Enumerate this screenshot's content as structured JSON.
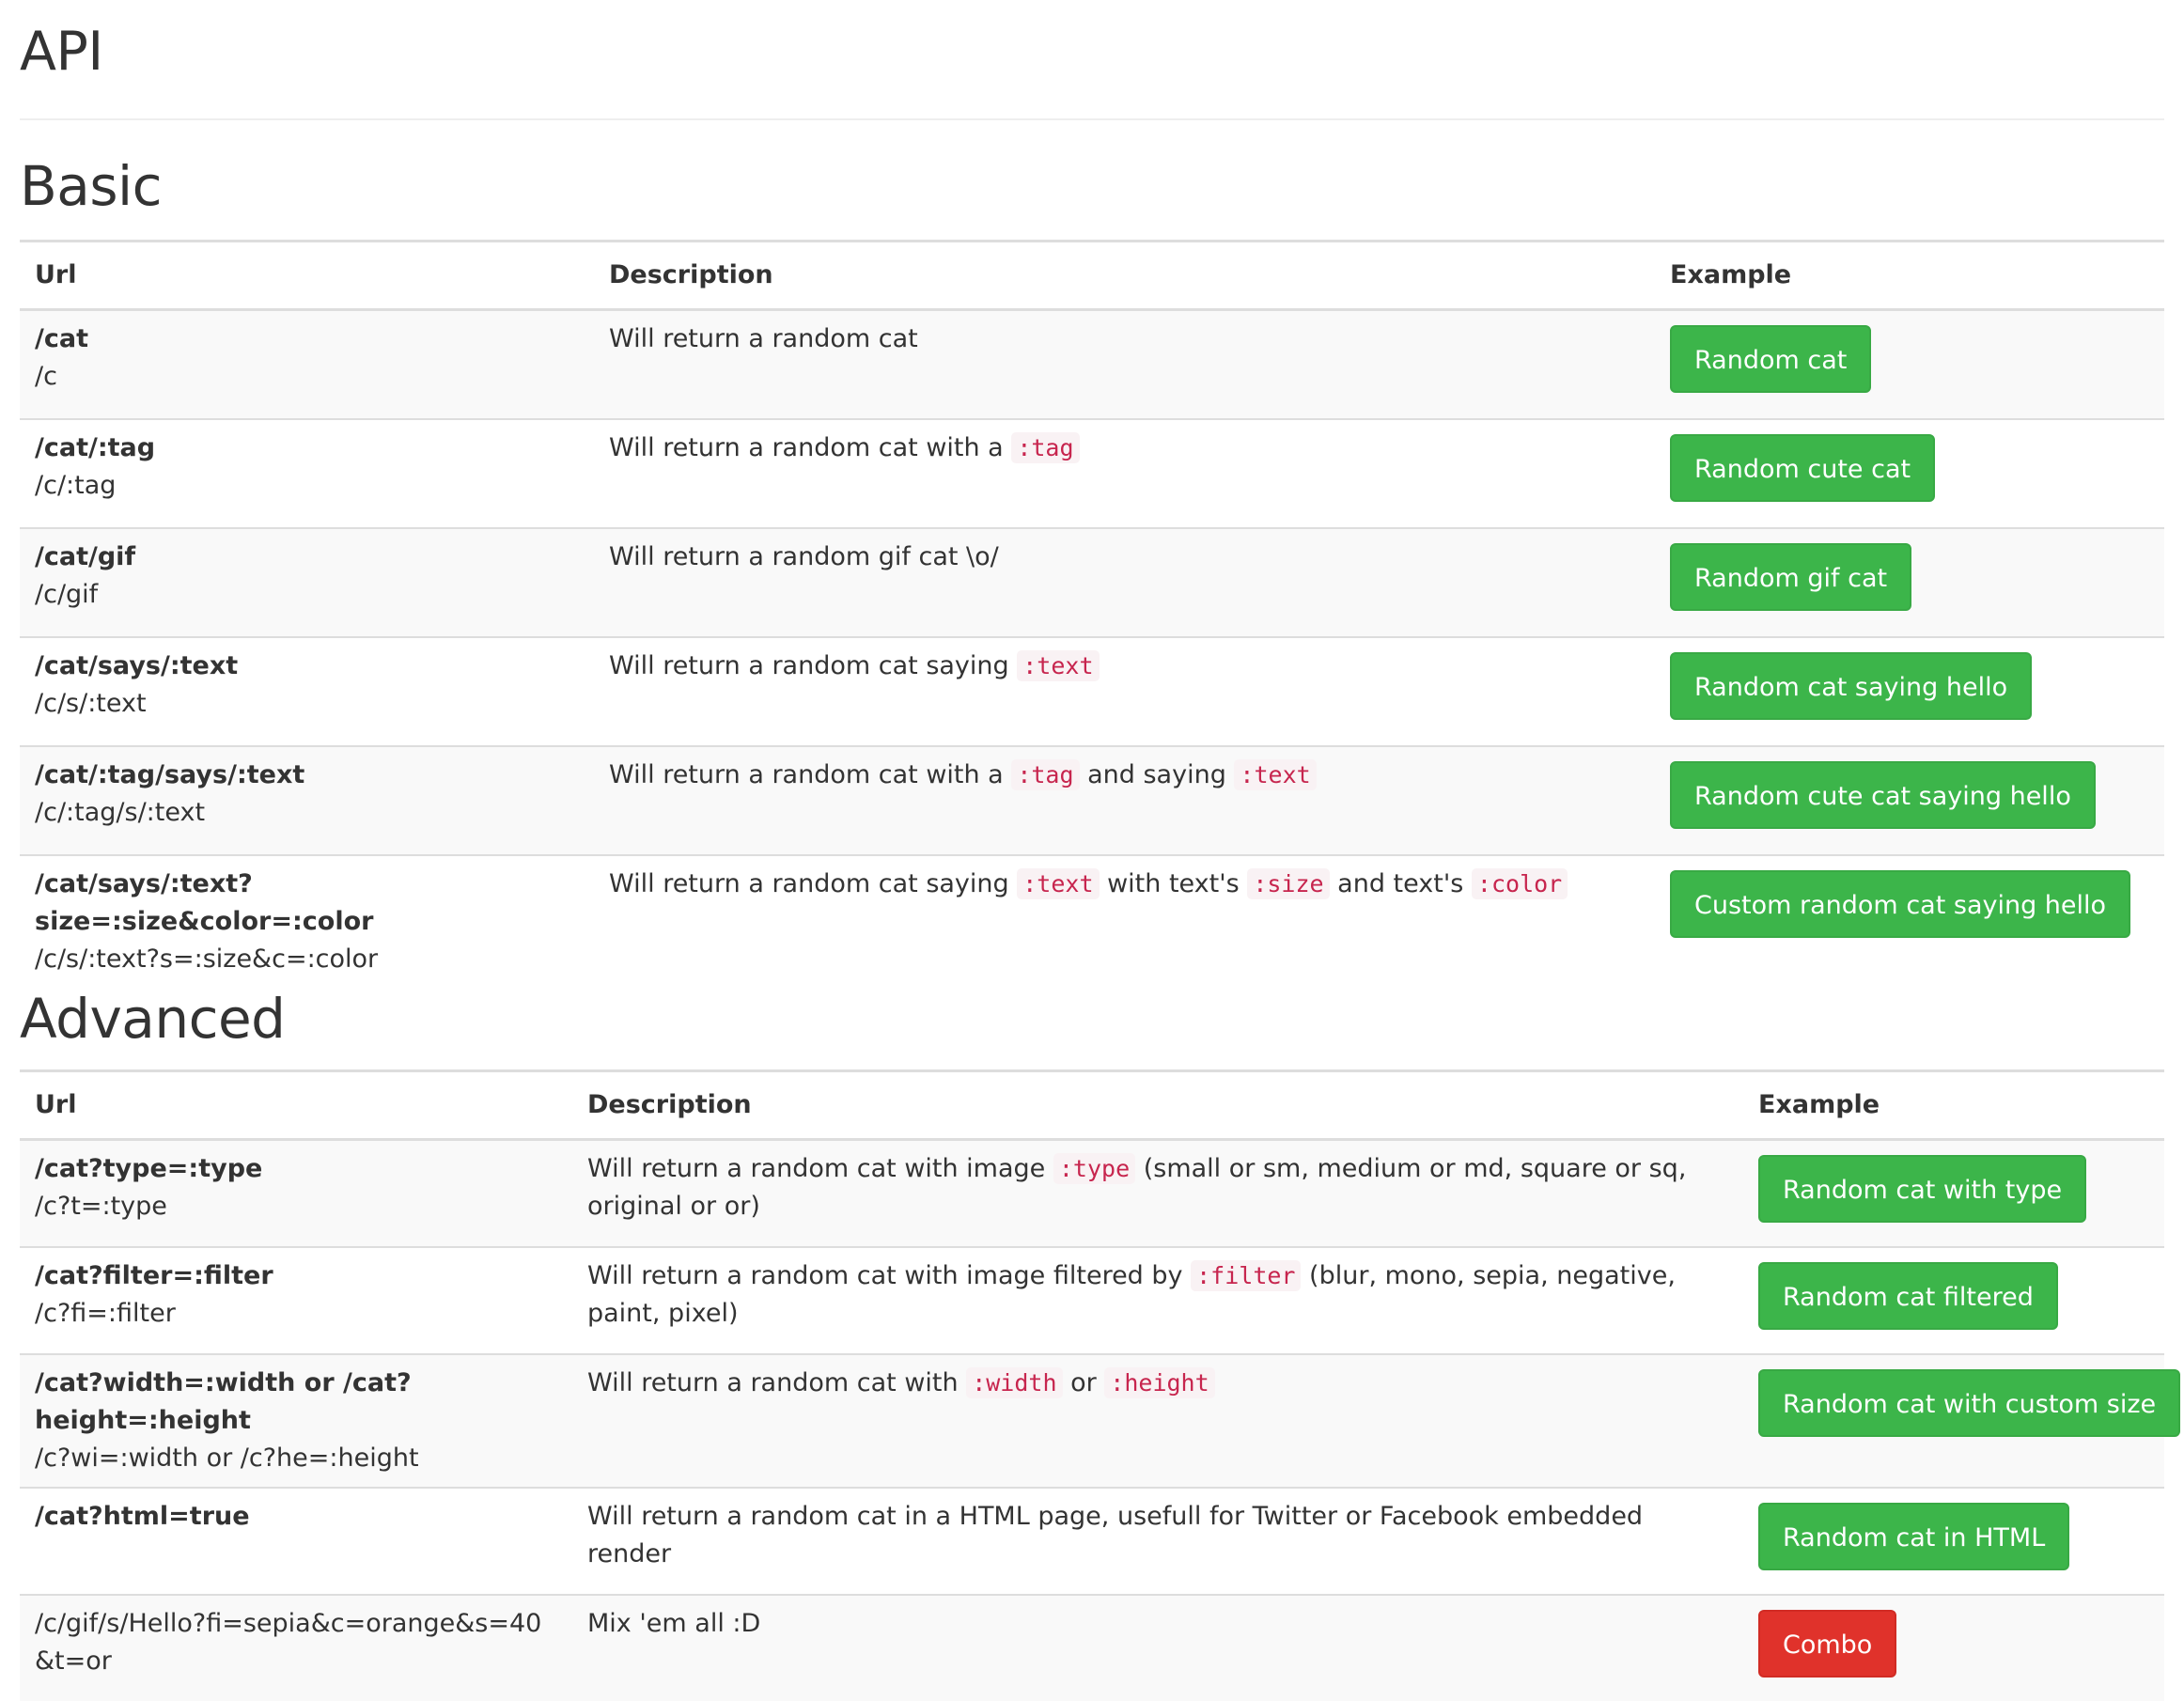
{
  "page": {
    "title": "API"
  },
  "basic": {
    "title": "Basic",
    "headers": {
      "url": "Url",
      "description": "Description",
      "example": "Example"
    },
    "rows": [
      {
        "url": "/cat",
        "short": "/c",
        "desc": [
          {
            "t": "Will return a random cat"
          }
        ],
        "button": "Random cat"
      },
      {
        "url": "/cat/:tag",
        "short": "/c/:tag",
        "desc": [
          {
            "t": "Will return a random cat with a "
          },
          {
            "code": ":tag"
          }
        ],
        "button": "Random cute cat"
      },
      {
        "url": "/cat/gif",
        "short": "/c/gif",
        "desc": [
          {
            "t": "Will return a random gif cat \\o/"
          }
        ],
        "button": "Random gif cat"
      },
      {
        "url": "/cat/says/:text",
        "short": "/c/s/:text",
        "desc": [
          {
            "t": "Will return a random cat saying "
          },
          {
            "code": ":text"
          }
        ],
        "button": "Random cat saying hello"
      },
      {
        "url": "/cat/:tag/says/:text",
        "short": "/c/:tag/s/:text",
        "desc": [
          {
            "t": "Will return a random cat with a "
          },
          {
            "code": ":tag"
          },
          {
            "t": " and saying "
          },
          {
            "code": ":text"
          }
        ],
        "button": "Random cute cat saying hello"
      },
      {
        "url": "/cat/says/:text?size=:size&color=:color",
        "short": "/c/s/:text?s=:size&c=:color",
        "desc": [
          {
            "t": "Will return a random cat saying "
          },
          {
            "code": ":text"
          },
          {
            "t": " with text's "
          },
          {
            "code": ":size"
          },
          {
            "t": " and text's "
          },
          {
            "code": ":color"
          }
        ],
        "button": "Custom random cat saying hello"
      }
    ]
  },
  "advanced": {
    "title": "Advanced",
    "headers": {
      "url": "Url",
      "description": "Description",
      "example": "Example"
    },
    "rows": [
      {
        "url": "/cat?type=:type",
        "short": "/c?t=:type",
        "desc": [
          {
            "t": "Will return a random cat with image "
          },
          {
            "code": ":type"
          },
          {
            "t": " (small or sm, medium or md, square or sq, original or or)"
          }
        ],
        "button": "Random cat with type"
      },
      {
        "url": "/cat?filter=:filter",
        "short": "/c?fi=:filter",
        "desc": [
          {
            "t": "Will return a random cat with image filtered by "
          },
          {
            "code": ":filter"
          },
          {
            "t": " (blur, mono, sepia, negative, paint, pixel)"
          }
        ],
        "button": "Random cat filtered"
      },
      {
        "url": "/cat?width=:width or /cat?height=:height",
        "short": "/c?wi=:width or /c?he=:height",
        "desc": [
          {
            "t": "Will return a random cat with "
          },
          {
            "code": ":width"
          },
          {
            "t": " or "
          },
          {
            "code": ":height"
          }
        ],
        "button": "Random cat with custom size"
      },
      {
        "url": "/cat?html=true",
        "short": "",
        "desc": [
          {
            "t": "Will return a random cat in a HTML page, usefull for Twitter or Facebook embedded render"
          }
        ],
        "button": "Random cat in HTML"
      },
      {
        "url": "",
        "short": "/c/gif/s/Hello?fi=sepia&c=orange&s=40&t=or",
        "desc": [
          {
            "t": "Mix 'em all :D"
          }
        ],
        "button": "Combo",
        "button_style": "danger"
      }
    ]
  },
  "colors": {
    "success": "#3cb54a",
    "danger": "#e0322b",
    "code_text": "#c7254e",
    "code_bg": "#f9f2f4"
  }
}
